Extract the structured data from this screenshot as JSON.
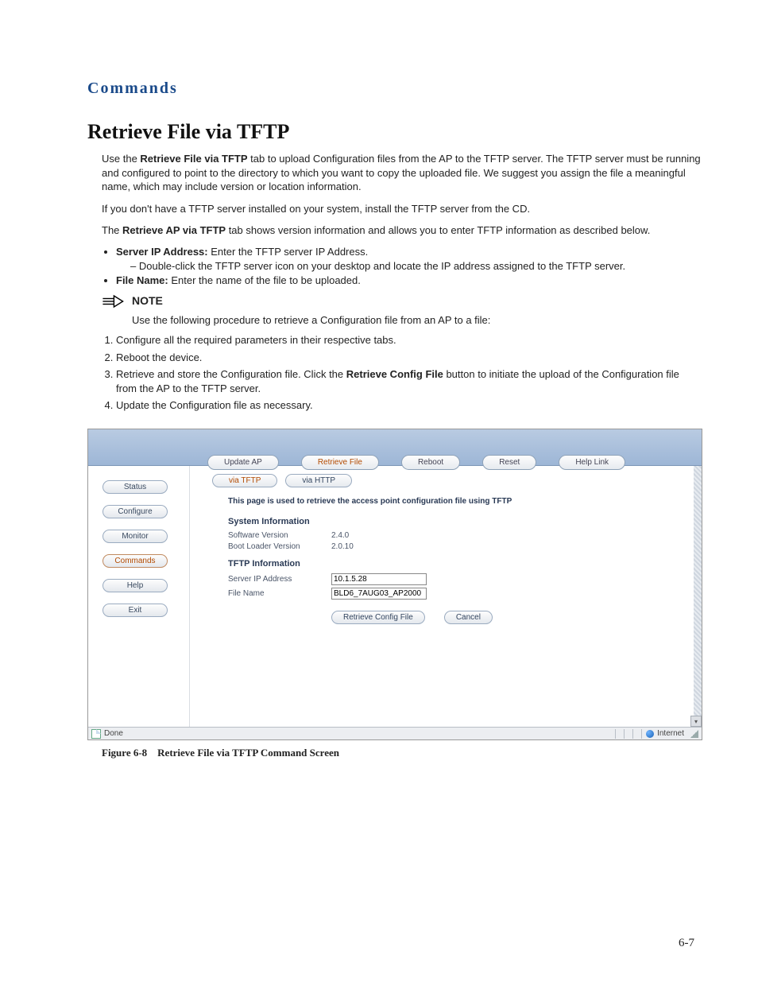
{
  "header": {
    "title": "Commands"
  },
  "section": {
    "title": "Retrieve File via TFTP"
  },
  "para": {
    "intro_a": "Use the ",
    "intro_bold": "Retrieve File via TFTP",
    "intro_b": " tab to upload Configuration files from the AP to the TFTP server. The TFTP server must be running and configured to point to the directory to which you want to copy the uploaded file. We suggest you assign the file a meaningful name, which may include version or location information.",
    "nocfg": "If you don't have a TFTP server installed on your system, install the TFTP server from the CD.",
    "retrieve_a": "The ",
    "retrieve_bold": "Retrieve AP via TFTP",
    "retrieve_b": " tab shows version information and allows you to enter TFTP information as described below."
  },
  "bullets": {
    "server_ip_bold": "Server IP Address:",
    "server_ip_rest": " Enter the TFTP server IP Address.",
    "server_ip_sub": "Double-click the TFTP server icon on your desktop and locate the IP address assigned to the TFTP server.",
    "filename_bold": "File Name:",
    "filename_rest": " Enter the name of the file to be uploaded."
  },
  "note": {
    "label": "NOTE",
    "text": "Use the following procedure to retrieve a Configuration file from an AP to a file:"
  },
  "steps": {
    "s1": "Configure all the required parameters in their respective tabs.",
    "s2": "Reboot the device.",
    "s3_a": "Retrieve and store the Configuration file. Click the ",
    "s3_bold": "Retrieve Config File",
    "s3_b": " button to initiate the upload of the Configuration file from the AP to the TFTP server.",
    "s4": "Update the Configuration file as necessary."
  },
  "app": {
    "top_tabs": {
      "update": "Update AP",
      "retrieve": "Retrieve File",
      "reboot": "Reboot",
      "reset": "Reset",
      "help": "Help Link"
    },
    "side": {
      "status": "Status",
      "configure": "Configure",
      "monitor": "Monitor",
      "commands": "Commands",
      "help": "Help",
      "exit": "Exit"
    },
    "sub_tabs": {
      "tftp": "via TFTP",
      "http": "via HTTP"
    },
    "panel": {
      "desc": "This page is used to retrieve the access point configuration file using TFTP",
      "sys_hdr": "System Information",
      "sw_label": "Software Version",
      "sw_value": "2.4.0",
      "bl_label": "Boot Loader Version",
      "bl_value": "2.0.10",
      "tftp_hdr": "TFTP Information",
      "ip_label": "Server IP Address",
      "ip_value": "10.1.5.28",
      "fn_label": "File Name",
      "fn_value": "BLD6_7AUG03_AP2000",
      "btn_retrieve": "Retrieve Config File",
      "btn_cancel": "Cancel"
    },
    "status": {
      "done": "Done",
      "internet": "Internet"
    }
  },
  "figure": {
    "label": "Figure 6-8",
    "title": "Retrieve File via TFTP Command Screen"
  },
  "page_number": "6-7"
}
